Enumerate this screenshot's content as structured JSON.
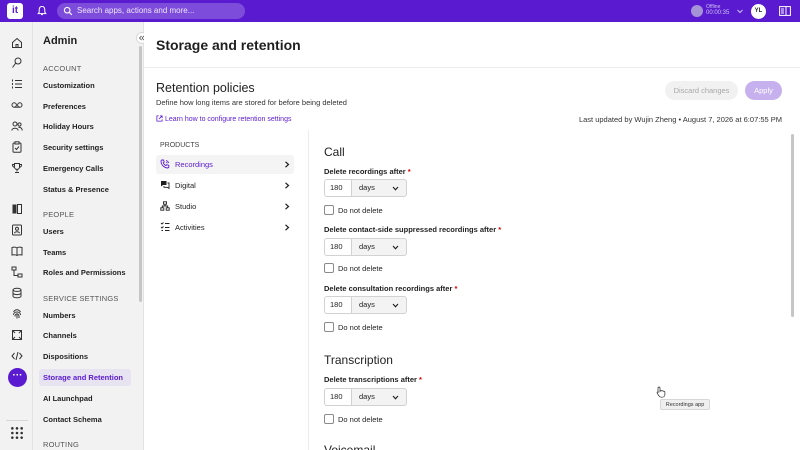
{
  "topbar": {
    "logo_text": "it",
    "search_placeholder": "Search apps, actions and more...",
    "status_label": "Offline",
    "status_timer": "00:00:35",
    "avatar_initials": "YL",
    "accent": "#5a1ad0"
  },
  "rail": {
    "icons": [
      "home-icon",
      "routes-icon",
      "queue-list-icon",
      "voicemail-icon",
      "people-icon",
      "clipboard-icon",
      "trophy-icon",
      "book-icon",
      "contact-card-icon",
      "reading-icon",
      "workflow-icon",
      "database-icon",
      "fingerprint-icon",
      "frame-icon",
      "code-icon",
      "more-icon",
      "apps-grid-icon"
    ],
    "more_label": "···"
  },
  "adminnav": {
    "title": "Admin",
    "sections": [
      {
        "label": "ACCOUNT",
        "items": [
          "Customization",
          "Preferences",
          "Holiday Hours",
          "Security settings",
          "Emergency Calls",
          "Status & Presence"
        ]
      },
      {
        "label": "PEOPLE",
        "items": [
          "Users",
          "Teams",
          "Roles and Permissions"
        ]
      },
      {
        "label": "SERVICE SETTINGS",
        "items": [
          "Numbers",
          "Channels",
          "Dispositions",
          "Storage and Retention",
          "AI Launchpad",
          "Contact Schema"
        ]
      },
      {
        "label": "ROUTING",
        "items": []
      }
    ],
    "active_item": "Storage and Retention"
  },
  "main": {
    "page_title": "Storage and retention",
    "card_title": "Retention policies",
    "card_subtitle": "Define how long items are stored for before being deleted",
    "learn_link": "Learn how to configure retention settings",
    "discard_label": "Discard changes",
    "apply_label": "Apply",
    "last_updated": "Last updated by Wujin Zheng • August 7, 2026 at 6:07:55 PM"
  },
  "products": {
    "label": "PRODUCTS",
    "items": [
      {
        "label": "Recordings",
        "icon": "phone-wave-icon",
        "active": true
      },
      {
        "label": "Digital",
        "icon": "chat-bubbles-icon",
        "active": false
      },
      {
        "label": "Studio",
        "icon": "workflow-icon",
        "active": false
      },
      {
        "label": "Activities",
        "icon": "activity-list-icon",
        "active": false
      }
    ]
  },
  "settings": {
    "call_title": "Call",
    "fields": [
      {
        "label": "Delete recordings after",
        "value": "180",
        "unit": "days",
        "checkbox": "Do not delete"
      },
      {
        "label": "Delete contact-side suppressed recordings after",
        "value": "180",
        "unit": "days",
        "checkbox": "Do not delete"
      },
      {
        "label": "Delete consultation recordings after",
        "value": "180",
        "unit": "days",
        "checkbox": "Do not delete"
      }
    ],
    "transcription_title": "Transcription",
    "transcription_field": {
      "label": "Delete transcriptions after",
      "value": "180",
      "unit": "days",
      "checkbox": "Do not delete"
    },
    "required_mark": "*",
    "next_title": "Voicemail"
  },
  "tooltip": "Recordings app"
}
